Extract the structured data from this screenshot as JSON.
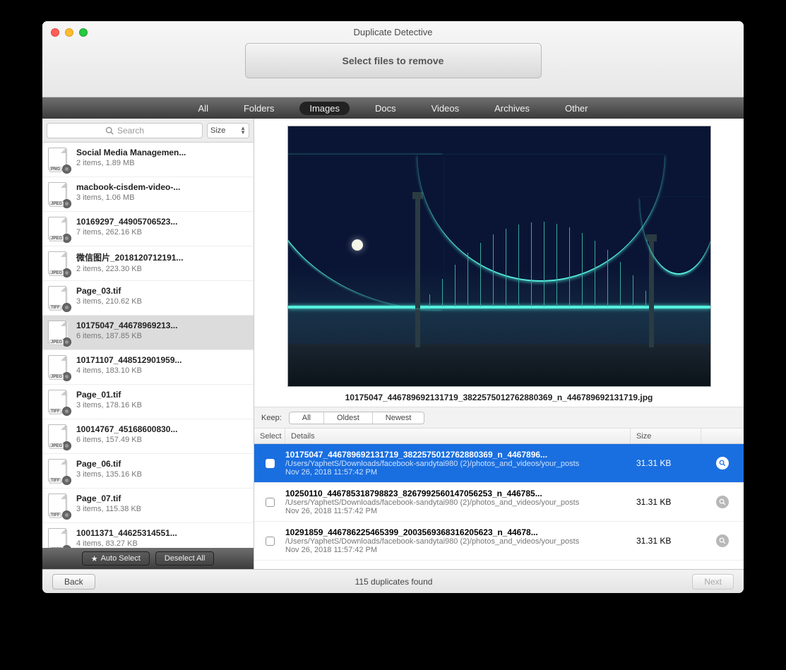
{
  "window": {
    "title": "Duplicate Detective",
    "banner": "Select files to remove"
  },
  "tabs": [
    {
      "label": "All",
      "active": false
    },
    {
      "label": "Folders",
      "active": false
    },
    {
      "label": "Images",
      "active": true
    },
    {
      "label": "Docs",
      "active": false
    },
    {
      "label": "Videos",
      "active": false
    },
    {
      "label": "Archives",
      "active": false
    },
    {
      "label": "Other",
      "active": false
    }
  ],
  "sidebar": {
    "search_placeholder": "Search",
    "sort_label": "Size",
    "auto_select_label": "Auto Select",
    "deselect_label": "Deselect All",
    "items": [
      {
        "name": "Social Media Managemen...",
        "meta": "2 items, 1.89 MB",
        "badge": "PNG",
        "selected": false
      },
      {
        "name": "macbook-cisdem-video-...",
        "meta": "3 items, 1.06 MB",
        "badge": "JPEG",
        "selected": false
      },
      {
        "name": "10169297_44905706523...",
        "meta": "7 items, 262.16 KB",
        "badge": "JPEG",
        "selected": false
      },
      {
        "name": "微信图片_2018120712191...",
        "meta": "2 items, 223.30 KB",
        "badge": "JPEG",
        "selected": false
      },
      {
        "name": "Page_03.tif",
        "meta": "3 items, 210.62 KB",
        "badge": "TIFF",
        "selected": false
      },
      {
        "name": "10175047_44678969213...",
        "meta": "6 items, 187.85 KB",
        "badge": "JPEG",
        "selected": true
      },
      {
        "name": "10171107_448512901959...",
        "meta": "4 items, 183.10 KB",
        "badge": "JPEG",
        "selected": false
      },
      {
        "name": "Page_01.tif",
        "meta": "3 items, 178.16 KB",
        "badge": "TIFF",
        "selected": false
      },
      {
        "name": "10014767_45168600830...",
        "meta": "6 items, 157.49 KB",
        "badge": "JPEG",
        "selected": false
      },
      {
        "name": "Page_06.tif",
        "meta": "3 items, 135.16 KB",
        "badge": "TIFF",
        "selected": false
      },
      {
        "name": "Page_07.tif",
        "meta": "3 items, 115.38 KB",
        "badge": "TIFF",
        "selected": false
      },
      {
        "name": "10011371_44625314551...",
        "meta": "4 items, 83.27 KB",
        "badge": "JPEG",
        "selected": false
      }
    ]
  },
  "preview": {
    "filename": "10175047_446789692131719_3822575012762880369_n_446789692131719.jpg",
    "keep_label": "Keep:",
    "keep_options": [
      "All",
      "Oldest",
      "Newest"
    ]
  },
  "columns": {
    "select": "Select",
    "details": "Details",
    "size": "Size"
  },
  "files": [
    {
      "name": "10175047_446789692131719_3822575012762880369_n_4467896...",
      "path": "/Users/YaphetS/Downloads/facebook-sandytai980 (2)/photos_and_videos/your_posts",
      "date": "Nov 26, 2018 11:57:42 PM",
      "size": "31.31 KB",
      "selected": true
    },
    {
      "name": "10250110_446785318798823_8267992560147056253_n_446785...",
      "path": "/Users/YaphetS/Downloads/facebook-sandytai980 (2)/photos_and_videos/your_posts",
      "date": "Nov 26, 2018 11:57:42 PM",
      "size": "31.31 KB",
      "selected": false
    },
    {
      "name": "10291859_446786225465399_2003569368316205623_n_44678...",
      "path": "/Users/YaphetS/Downloads/facebook-sandytai980 (2)/photos_and_videos/your_posts",
      "date": "Nov 26, 2018 11:57:42 PM",
      "size": "31.31 KB",
      "selected": false
    }
  ],
  "footer": {
    "back": "Back",
    "status": "115 duplicates found",
    "next": "Next"
  }
}
